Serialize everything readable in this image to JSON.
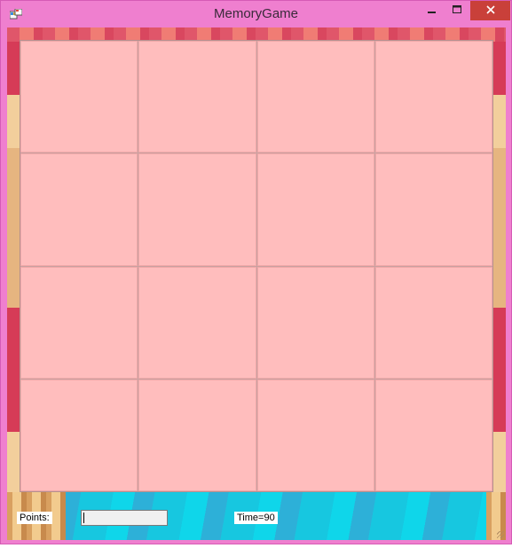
{
  "window": {
    "title": "MemoryGame",
    "app_icon": "windows-forms-app-icon",
    "controls": {
      "minimize_icon": "minimize-icon",
      "maximize_icon": "maximize-icon",
      "close_icon": "close-icon",
      "close_color": "#c9403a"
    },
    "frame_color": "#ef7fcf"
  },
  "board": {
    "rows": 4,
    "columns": 4,
    "card_color": "#ffbdbd",
    "cards": [
      "",
      "",
      "",
      "",
      "",
      "",
      "",
      "",
      "",
      "",
      "",
      "",
      "",
      "",
      "",
      ""
    ]
  },
  "status": {
    "points_label": "Points:",
    "points_value": "",
    "time_label": "Time=90"
  }
}
